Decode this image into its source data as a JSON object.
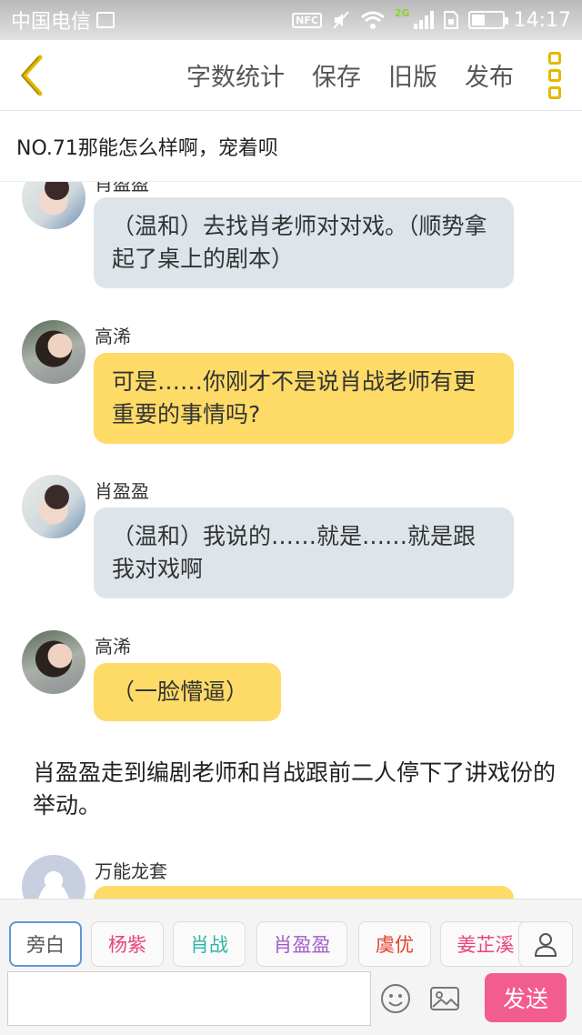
{
  "status_bar": {
    "carrier": "中国电信",
    "nfc_label": "NFC",
    "network_label": "2G",
    "time": "14:17",
    "battery_level_percent": 45
  },
  "toolbar": {
    "back_icon": "chevron-left-icon",
    "word_count": "字数统计",
    "save": "保存",
    "old_version": "旧版",
    "publish": "发布",
    "menu_icon": "menu-dots-icon",
    "accent_color": "#e6b800"
  },
  "chapter_title": "NO.71那能怎么样啊，宠着呗",
  "messages": [
    {
      "type": "bubble",
      "speaker": "肖盈盈",
      "style": "blue",
      "text": "（温和）去找肖老师对对戏。（顺势拿起了桌上的剧本）"
    },
    {
      "type": "bubble",
      "speaker": "高浠",
      "style": "yellow",
      "text": "可是……你刚才不是说肖战老师有更重要的事情吗?"
    },
    {
      "type": "bubble",
      "speaker": "肖盈盈",
      "style": "blue",
      "text": "（温和）我说的……就是……就是跟我对戏啊"
    },
    {
      "type": "bubble",
      "speaker": "高浠",
      "style": "yellow",
      "text": "（一脸懵逼）"
    },
    {
      "type": "narration",
      "text": "肖盈盈走到编剧老师和肖战跟前二人停下了讲戏份的举动。"
    },
    {
      "type": "bubble",
      "speaker": "万能龙套",
      "style": "yellow",
      "text": ""
    }
  ],
  "roles": [
    {
      "label": "旁白",
      "color": "#555555",
      "selected": true
    },
    {
      "label": "杨紫",
      "color": "#e8457a",
      "selected": false
    },
    {
      "label": "肖战",
      "color": "#2fb5a5",
      "selected": false
    },
    {
      "label": "肖盈盈",
      "color": "#a25ec7",
      "selected": false
    },
    {
      "label": "虞优",
      "color": "#e0452f",
      "selected": false
    },
    {
      "label": "姜芷溪",
      "color": "#e8457a",
      "selected": false
    }
  ],
  "input": {
    "placeholder": "",
    "value": "",
    "send": "发送",
    "send_color": "#f25c8e"
  },
  "colors": {
    "bubble_blue": "#dde5ea",
    "bubble_yellow": "#fedb67"
  }
}
